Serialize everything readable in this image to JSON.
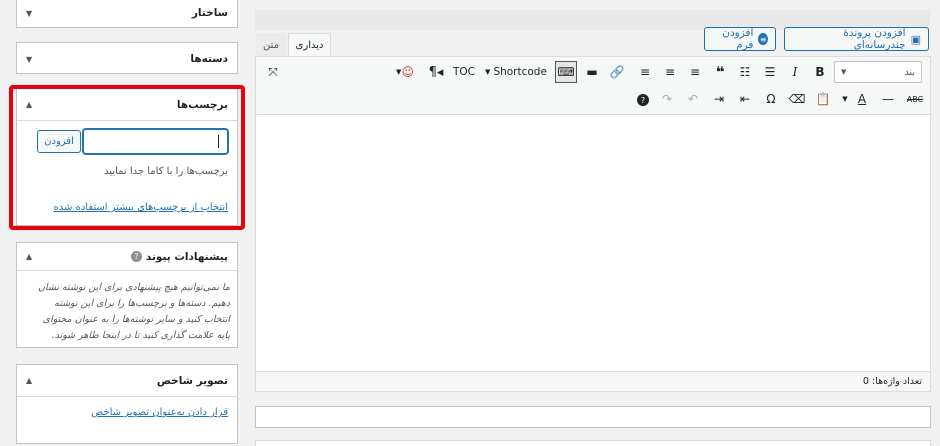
{
  "sidebar": {
    "structure_title": "ساختار",
    "categories_title": "دسته‌ها",
    "tags": {
      "title": "برچسب‌ها",
      "add_button": "افزودن",
      "hint": "برچسب‌ها را با کاما جدا نمایید",
      "choose_link": "انتخاب از برچسب‌های بیشتر استفاده شده"
    },
    "link_suggestions": {
      "title": "پیشنهادات پیوند",
      "text": "ما نمی‌توانیم هیچ پیشنهادی برای این نوشته نشان دهیم. دسته‌ها و برچسب‌ها را برای این نوشته انتخاب کنید و سایر نوشته‌ها را به عنوان محتوای پایه علامت گذاری کنید تا در اینجا ظاهر شوند."
    },
    "featured_image": {
      "title": "تصویر شاخص",
      "set_link": "قرار دادن به‌عنوان تصویر شاخص"
    }
  },
  "editor": {
    "add_media_button": "افزودن پروندهٔ چندرسانه‌ای",
    "add_form_button": "افزودن فرم",
    "tab_visual": "دیداری",
    "tab_text": "متن",
    "format_select": "بند",
    "shortcode_label": "Shortcode",
    "toc_label": "TOC",
    "word_count": "تعداد واژه‌ها: 0"
  },
  "colors": {
    "accent": "#2271b1",
    "highlight": "#e8000b"
  }
}
